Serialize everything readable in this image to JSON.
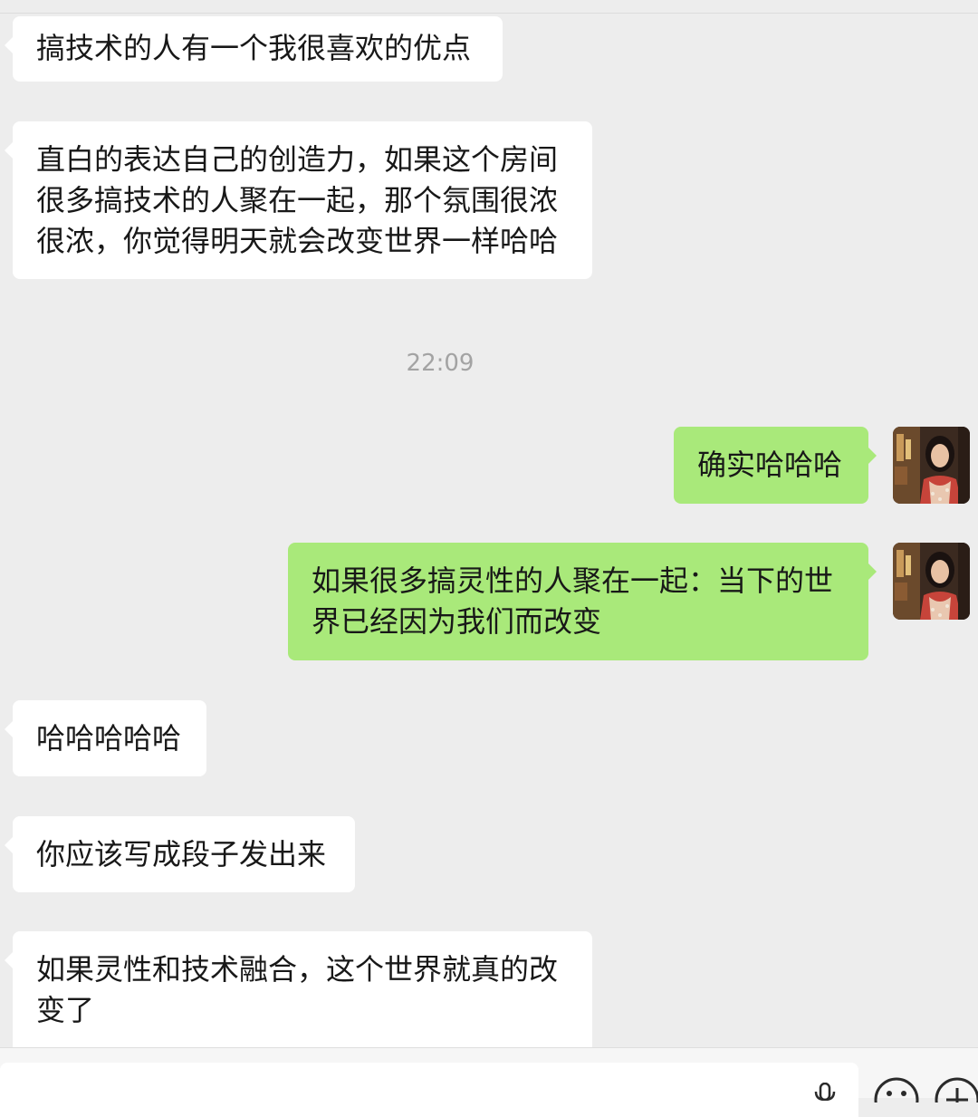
{
  "chat": {
    "messages": [
      {
        "text": "搞技术的人有一个我很喜欢的优点",
        "sender": "other"
      },
      {
        "text": "直白的表达自己的创造力，如果这个房间很多搞技术的人聚在一起，那个氛围很浓很浓，你觉得明天就会改变世界一样哈哈",
        "sender": "other"
      },
      {
        "text": "确实哈哈哈",
        "sender": "self"
      },
      {
        "text": "如果很多搞灵性的人聚在一起：当下的世界已经因为我们而改变",
        "sender": "self"
      },
      {
        "text": "哈哈哈哈哈",
        "sender": "other"
      },
      {
        "text": "你应该写成段子发出来",
        "sender": "other"
      },
      {
        "text": "如果灵性和技术融合，这个世界就真的改变了",
        "sender": "other"
      }
    ],
    "timestamp": "22:09"
  },
  "colors": {
    "background": "#ededed",
    "incoming_bubble": "#ffffff",
    "outgoing_bubble": "#a9e97a",
    "timestamp_text": "#a3a3a3"
  },
  "input_bar": {
    "icons": [
      "voice-input-icon",
      "emoji-icon",
      "plus-icon"
    ]
  }
}
